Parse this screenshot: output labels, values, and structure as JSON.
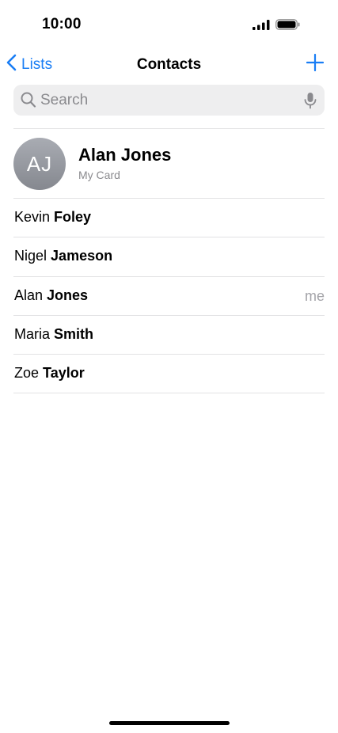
{
  "status_bar": {
    "time": "10:00",
    "icons": [
      "signal-icon",
      "battery-icon"
    ]
  },
  "nav": {
    "back_label": "Lists",
    "title": "Contacts",
    "add_icon": "plus-icon",
    "accent_color": "#1a7ef5"
  },
  "search": {
    "placeholder": "Search",
    "value": "",
    "icons": [
      "search-icon",
      "microphone-icon"
    ]
  },
  "my_card": {
    "initials": "AJ",
    "name": "Alan Jones",
    "subtitle": "My Card"
  },
  "contacts": [
    {
      "first": "Kevin",
      "last": "Foley",
      "badge": ""
    },
    {
      "first": "Nigel",
      "last": "Jameson",
      "badge": ""
    },
    {
      "first": "Alan",
      "last": "Jones",
      "badge": "me"
    },
    {
      "first": "Maria",
      "last": "Smith",
      "badge": ""
    },
    {
      "first": "Zoe",
      "last": "Taylor",
      "badge": ""
    }
  ]
}
